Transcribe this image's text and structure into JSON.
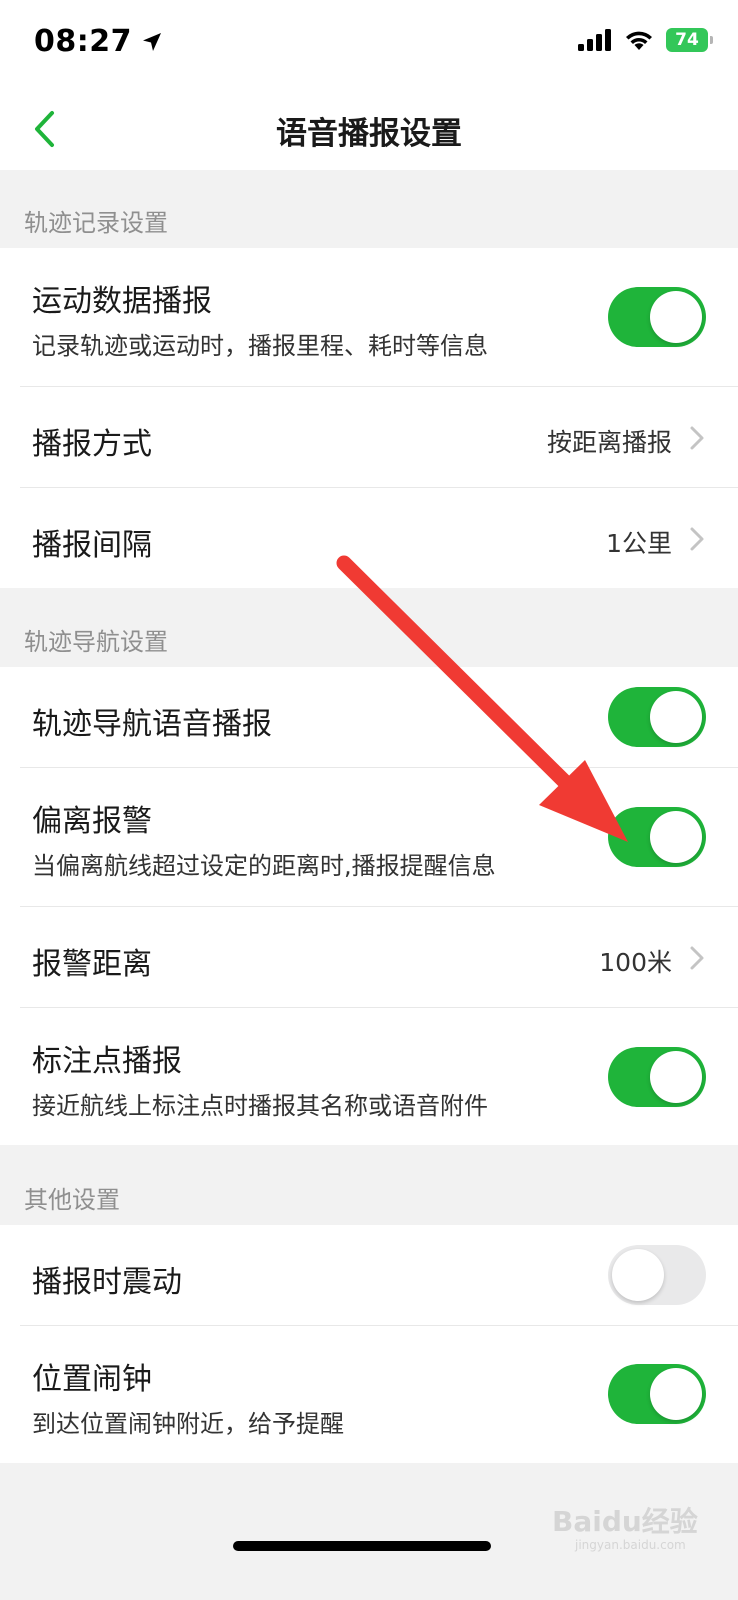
{
  "status_bar": {
    "time": "08:27",
    "battery": "74"
  },
  "nav": {
    "title": "语音播报设置"
  },
  "sections": {
    "track_record": {
      "header": "轨迹记录设置",
      "sport_data": {
        "title": "运动数据播报",
        "subtitle": "记录轨迹或运动时，播报里程、耗时等信息",
        "enabled": true
      },
      "mode": {
        "title": "播报方式",
        "value": "按距离播报"
      },
      "interval": {
        "title": "播报间隔",
        "value": "1公里"
      }
    },
    "track_nav": {
      "header": "轨迹导航设置",
      "voice": {
        "title": "轨迹导航语音播报",
        "enabled": true
      },
      "deviation": {
        "title": "偏离报警",
        "subtitle": "当偏离航线超过设定的距离时,播报提醒信息",
        "enabled": true
      },
      "alarm_distance": {
        "title": "报警距离",
        "value": "100米"
      },
      "marker": {
        "title": "标注点播报",
        "subtitle": "接近航线上标注点时播报其名称或语音附件",
        "enabled": true
      }
    },
    "other": {
      "header": "其他设置",
      "vibrate": {
        "title": "播报时震动",
        "enabled": false
      },
      "location_alarm": {
        "title": "位置闹钟",
        "subtitle": "到达位置闹钟附近，给予提醒",
        "enabled": true
      }
    }
  },
  "colors": {
    "accent_green": "#1fb43a",
    "toggle_off": "#e9e9ea",
    "annotation_arrow": "#f03a33",
    "page_background": "#f2f2f2"
  },
  "icons": {
    "back": "chevron-left-icon",
    "row_arrow": "chevron-right-icon",
    "location": "location-arrow-icon",
    "signal": "signal-icon",
    "wifi": "wifi-icon",
    "battery": "battery-icon"
  },
  "watermark": {
    "brand": "Baidu经验",
    "sub": "jingyan.baidu.com"
  }
}
